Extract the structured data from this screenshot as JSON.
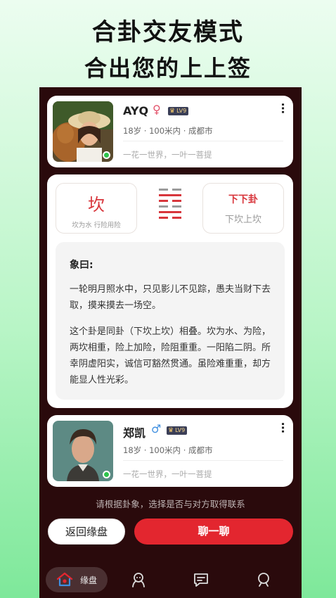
{
  "headline": {
    "line1": "合卦交友模式",
    "line2": "合出您的上上签"
  },
  "profiles": [
    {
      "name": "AYQ",
      "gender_symbol": "♀",
      "level": "LV9",
      "age": "18岁",
      "distance": "100米内",
      "city": "成都市",
      "motto": "一花一世界，一叶一菩提",
      "online": true
    },
    {
      "name": "郑凯",
      "gender_symbol": "♂",
      "level": "LV9",
      "age": "18岁",
      "distance": "100米内",
      "city": "成都市",
      "motto": "一花一世界，一叶一菩提",
      "online": true
    }
  ],
  "gua": {
    "name": "坎",
    "subtitle": "坎为水 行险用险",
    "rank": "下下卦",
    "composition": "下坎上坎",
    "xiang_title": "象曰:",
    "xiang_p1": "一轮明月照水中，只见影儿不见踪，愚夫当财下去取，摸来摸去一场空。",
    "xiang_p2": "这个卦是同卦（下坎上坎）相叠。坎为水、为险，两坎相重，险上加险，险阻重重。一阳陷二阴。所幸阴虚阳实，诚信可豁然贯通。虽险难重重，却方能显人性光彩。"
  },
  "hint": "请根据卦象，选择是否与对方取得联系",
  "actions": {
    "back": "返回缘盘",
    "chat": "聊一聊"
  },
  "tabs": [
    {
      "label": "缘盘",
      "icon": "home-icon",
      "active": true
    },
    {
      "icon": "match-icon"
    },
    {
      "icon": "message-icon"
    },
    {
      "icon": "profile-icon"
    }
  ],
  "colors": {
    "accent": "#e3262f",
    "gua_red": "#d8363c",
    "phone_bg": "#2a0a0c"
  }
}
